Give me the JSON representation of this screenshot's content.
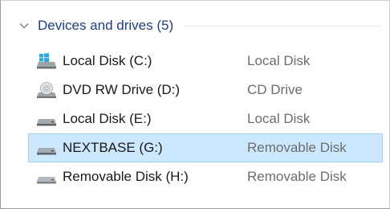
{
  "group": {
    "title": "Devices and drives (5)",
    "expanded": true
  },
  "drives": [
    {
      "name": "Local Disk (C:)",
      "type": "Local Disk",
      "icon": "windows-system-drive-icon",
      "selected": false
    },
    {
      "name": "DVD RW Drive (D:)",
      "type": "CD Drive",
      "icon": "dvd-drive-icon",
      "selected": false
    },
    {
      "name": "Local Disk (E:)",
      "type": "Local Disk",
      "icon": "hard-drive-icon",
      "selected": false
    },
    {
      "name": "NEXTBASE (G:)",
      "type": "Removable Disk",
      "icon": "removable-drive-icon",
      "selected": true
    },
    {
      "name": "Removable Disk (H:)",
      "type": "Removable Disk",
      "icon": "removable-drive-icon",
      "selected": false
    }
  ],
  "colors": {
    "group_title": "#1e3c8c",
    "selection_fill": "#cce8ff",
    "selection_border": "#99d1ff",
    "type_text": "#6d6d6d"
  }
}
